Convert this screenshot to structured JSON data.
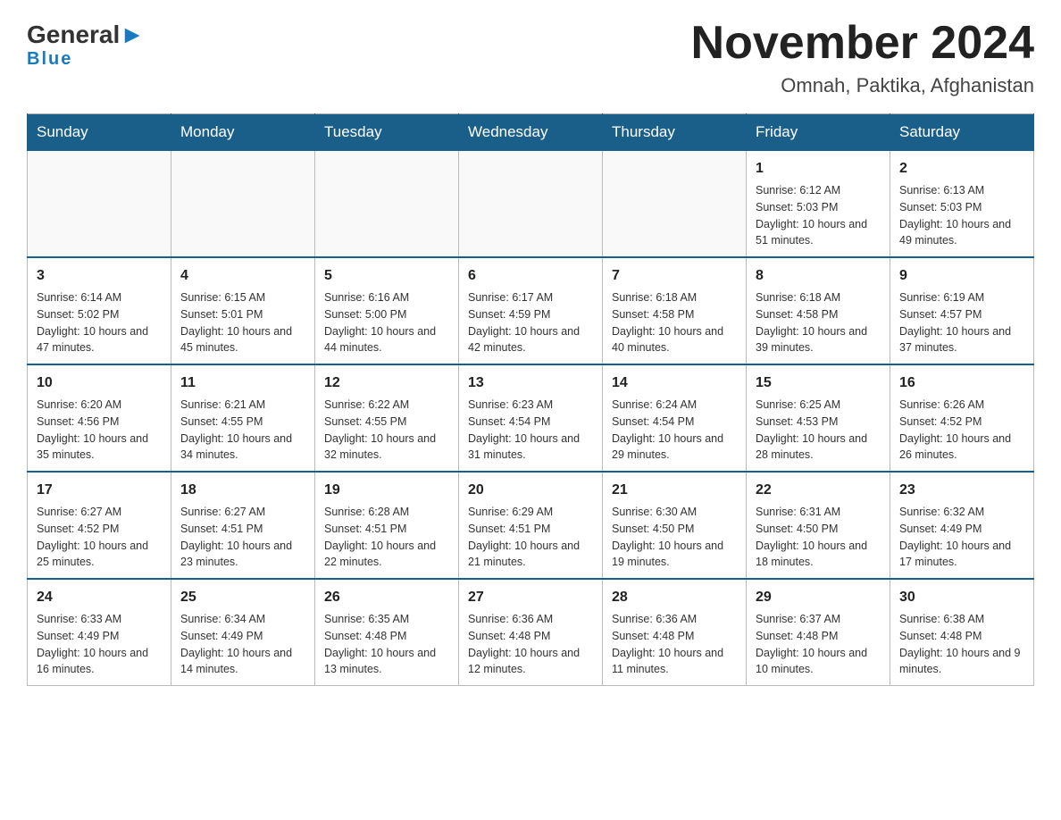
{
  "header": {
    "logo": {
      "text_general": "General",
      "text_blue": "Blue"
    },
    "title": "November 2024",
    "location": "Omnah, Paktika, Afghanistan"
  },
  "calendar": {
    "days_of_week": [
      "Sunday",
      "Monday",
      "Tuesday",
      "Wednesday",
      "Thursday",
      "Friday",
      "Saturday"
    ],
    "weeks": [
      {
        "days": [
          {
            "num": "",
            "info": ""
          },
          {
            "num": "",
            "info": ""
          },
          {
            "num": "",
            "info": ""
          },
          {
            "num": "",
            "info": ""
          },
          {
            "num": "",
            "info": ""
          },
          {
            "num": "1",
            "info": "Sunrise: 6:12 AM\nSunset: 5:03 PM\nDaylight: 10 hours and 51 minutes."
          },
          {
            "num": "2",
            "info": "Sunrise: 6:13 AM\nSunset: 5:03 PM\nDaylight: 10 hours and 49 minutes."
          }
        ]
      },
      {
        "days": [
          {
            "num": "3",
            "info": "Sunrise: 6:14 AM\nSunset: 5:02 PM\nDaylight: 10 hours and 47 minutes."
          },
          {
            "num": "4",
            "info": "Sunrise: 6:15 AM\nSunset: 5:01 PM\nDaylight: 10 hours and 45 minutes."
          },
          {
            "num": "5",
            "info": "Sunrise: 6:16 AM\nSunset: 5:00 PM\nDaylight: 10 hours and 44 minutes."
          },
          {
            "num": "6",
            "info": "Sunrise: 6:17 AM\nSunset: 4:59 PM\nDaylight: 10 hours and 42 minutes."
          },
          {
            "num": "7",
            "info": "Sunrise: 6:18 AM\nSunset: 4:58 PM\nDaylight: 10 hours and 40 minutes."
          },
          {
            "num": "8",
            "info": "Sunrise: 6:18 AM\nSunset: 4:58 PM\nDaylight: 10 hours and 39 minutes."
          },
          {
            "num": "9",
            "info": "Sunrise: 6:19 AM\nSunset: 4:57 PM\nDaylight: 10 hours and 37 minutes."
          }
        ]
      },
      {
        "days": [
          {
            "num": "10",
            "info": "Sunrise: 6:20 AM\nSunset: 4:56 PM\nDaylight: 10 hours and 35 minutes."
          },
          {
            "num": "11",
            "info": "Sunrise: 6:21 AM\nSunset: 4:55 PM\nDaylight: 10 hours and 34 minutes."
          },
          {
            "num": "12",
            "info": "Sunrise: 6:22 AM\nSunset: 4:55 PM\nDaylight: 10 hours and 32 minutes."
          },
          {
            "num": "13",
            "info": "Sunrise: 6:23 AM\nSunset: 4:54 PM\nDaylight: 10 hours and 31 minutes."
          },
          {
            "num": "14",
            "info": "Sunrise: 6:24 AM\nSunset: 4:54 PM\nDaylight: 10 hours and 29 minutes."
          },
          {
            "num": "15",
            "info": "Sunrise: 6:25 AM\nSunset: 4:53 PM\nDaylight: 10 hours and 28 minutes."
          },
          {
            "num": "16",
            "info": "Sunrise: 6:26 AM\nSunset: 4:52 PM\nDaylight: 10 hours and 26 minutes."
          }
        ]
      },
      {
        "days": [
          {
            "num": "17",
            "info": "Sunrise: 6:27 AM\nSunset: 4:52 PM\nDaylight: 10 hours and 25 minutes."
          },
          {
            "num": "18",
            "info": "Sunrise: 6:27 AM\nSunset: 4:51 PM\nDaylight: 10 hours and 23 minutes."
          },
          {
            "num": "19",
            "info": "Sunrise: 6:28 AM\nSunset: 4:51 PM\nDaylight: 10 hours and 22 minutes."
          },
          {
            "num": "20",
            "info": "Sunrise: 6:29 AM\nSunset: 4:51 PM\nDaylight: 10 hours and 21 minutes."
          },
          {
            "num": "21",
            "info": "Sunrise: 6:30 AM\nSunset: 4:50 PM\nDaylight: 10 hours and 19 minutes."
          },
          {
            "num": "22",
            "info": "Sunrise: 6:31 AM\nSunset: 4:50 PM\nDaylight: 10 hours and 18 minutes."
          },
          {
            "num": "23",
            "info": "Sunrise: 6:32 AM\nSunset: 4:49 PM\nDaylight: 10 hours and 17 minutes."
          }
        ]
      },
      {
        "days": [
          {
            "num": "24",
            "info": "Sunrise: 6:33 AM\nSunset: 4:49 PM\nDaylight: 10 hours and 16 minutes."
          },
          {
            "num": "25",
            "info": "Sunrise: 6:34 AM\nSunset: 4:49 PM\nDaylight: 10 hours and 14 minutes."
          },
          {
            "num": "26",
            "info": "Sunrise: 6:35 AM\nSunset: 4:48 PM\nDaylight: 10 hours and 13 minutes."
          },
          {
            "num": "27",
            "info": "Sunrise: 6:36 AM\nSunset: 4:48 PM\nDaylight: 10 hours and 12 minutes."
          },
          {
            "num": "28",
            "info": "Sunrise: 6:36 AM\nSunset: 4:48 PM\nDaylight: 10 hours and 11 minutes."
          },
          {
            "num": "29",
            "info": "Sunrise: 6:37 AM\nSunset: 4:48 PM\nDaylight: 10 hours and 10 minutes."
          },
          {
            "num": "30",
            "info": "Sunrise: 6:38 AM\nSunset: 4:48 PM\nDaylight: 10 hours and 9 minutes."
          }
        ]
      }
    ]
  }
}
